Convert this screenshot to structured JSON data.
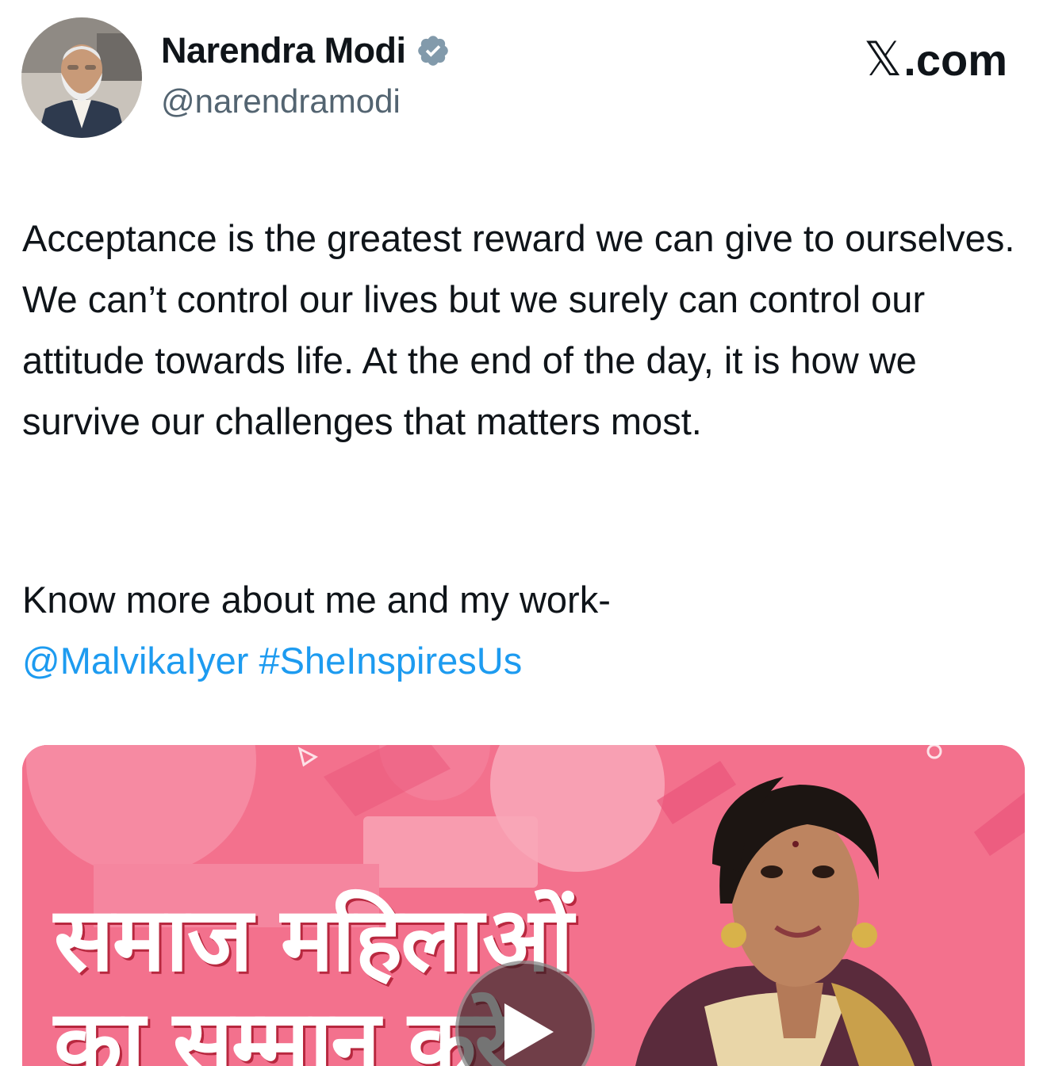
{
  "author": {
    "display_name": "Narendra Modi",
    "handle": "@narendramodi",
    "verified": true,
    "verified_color": "#829aab"
  },
  "brand": {
    "icon": "x-logo-icon",
    "glyph": "𝕏",
    "suffix": ".com"
  },
  "tweet": {
    "paragraph_1": "Acceptance is the greatest reward we can give to ourselves. We can’t control our lives but we surely can control our attitude towards life. At the end of the day, it is how we survive our challenges that matters most.",
    "know_more": "Know more about me and my work-",
    "mention": "@MalvikaIyer",
    "hashtag": "#SheInspiresUs",
    "link_color": "#1d9bf0"
  },
  "media": {
    "type": "video",
    "overlay_line_1": "समाज महिलाओं",
    "overlay_line_2": "का सम्मान करे",
    "background_color": "#f3718d",
    "play_icon": "play-icon"
  }
}
